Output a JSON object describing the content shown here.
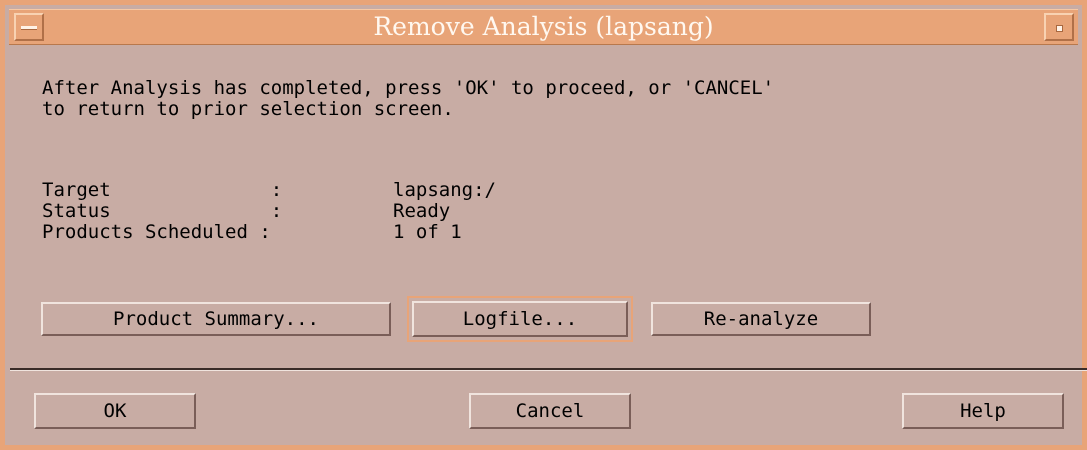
{
  "window": {
    "title": "Remove Analysis (lapsang)"
  },
  "message": {
    "line1": "After Analysis has completed, press 'OK' to proceed, or 'CANCEL'",
    "line2": "to return to prior selection screen."
  },
  "info": [
    {
      "label": "Target              :",
      "value": "lapsang:/"
    },
    {
      "label": "Status              :",
      "value": "Ready"
    },
    {
      "label": "Products Scheduled :",
      "value": "1 of 1"
    }
  ],
  "actions": {
    "product_summary": "Product Summary...",
    "logfile": "Logfile...",
    "reanalyze": "Re-analyze"
  },
  "footer": {
    "ok": "OK",
    "cancel": "Cancel",
    "help": "Help"
  },
  "colors": {
    "titlebar": "#e8a478",
    "background": "#c8aca4"
  }
}
